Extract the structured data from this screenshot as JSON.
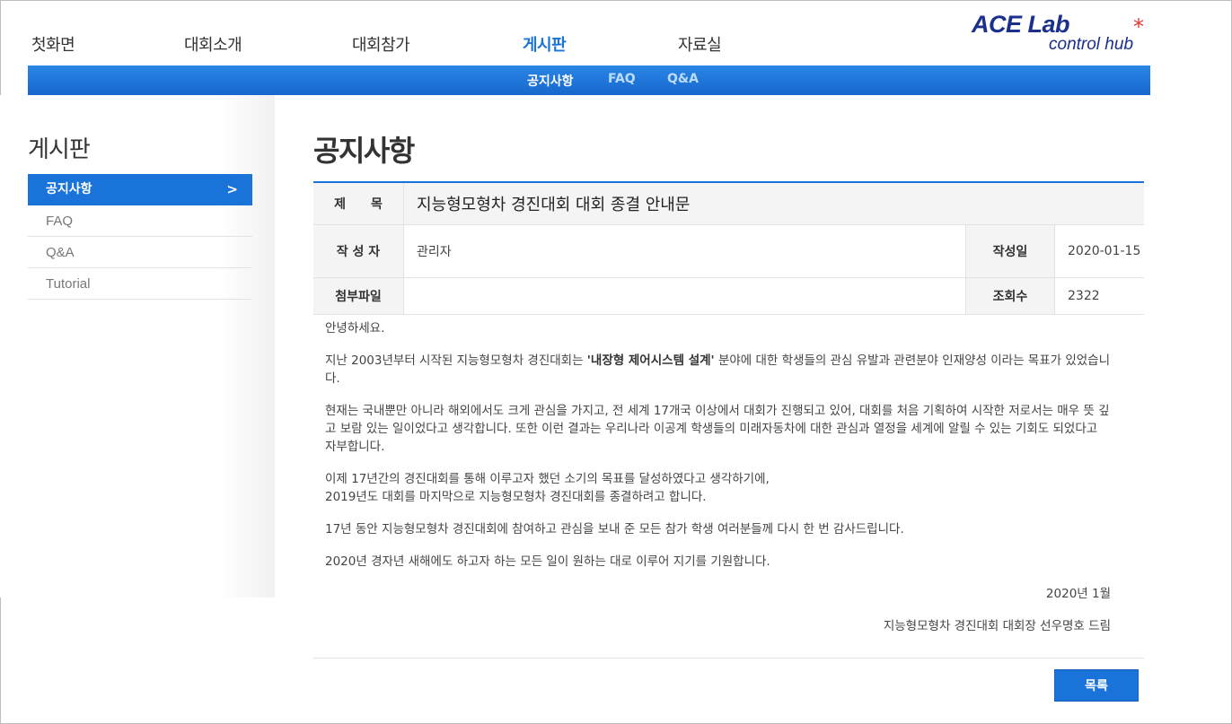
{
  "gnb": {
    "items": [
      {
        "label": "첫화면"
      },
      {
        "label": "대회소개"
      },
      {
        "label": "대회참가"
      },
      {
        "label": "게시판"
      },
      {
        "label": "자료실"
      }
    ]
  },
  "logo": {
    "line1": "ACE Lab",
    "line2": "control hub",
    "mark": "*"
  },
  "subnav": {
    "items": [
      {
        "label": "공지사항"
      },
      {
        "label": "FAQ"
      },
      {
        "label": "Q&A"
      }
    ]
  },
  "sidebar": {
    "title": "게시판",
    "items": [
      {
        "label": "공지사항"
      },
      {
        "label": "FAQ"
      },
      {
        "label": "Q&A"
      },
      {
        "label": "Tutorial"
      }
    ],
    "active_arrow": ">"
  },
  "content": {
    "title": "공지사항",
    "subject_label": "제　　목",
    "subject": "지능형모형차 경진대회 대회 종결 안내문",
    "author_label": "작 성 자",
    "author": "관리자",
    "date_label": "작성일",
    "date": "2020-01-15",
    "attach_label": "첨부파일",
    "attach": "",
    "views_label": "조회수",
    "views": "2322",
    "body": {
      "p1": "안녕하세요.",
      "p2_pre": "지난 2003년부터 시작된 지능형모형차 경진대회는 ",
      "p2_bold": "'내장형 제어시스템 설계'",
      "p2_post": " 분야에 대한 학생들의 관심 유발과 관련분야 인재양성 이라는 목표가 있었습니다.",
      "p3": "현재는 국내뿐만 아니라 해외에서도 크게 관심을 가지고, 전 세계 17개국 이상에서 대회가 진행되고 있어, 대회를 처음 기획하여 시작한 저로서는 매우 뜻 깊고 보람 있는 일이었다고 생각합니다. 또한 이런 결과는 우리나라 이공계 학생들의 미래자동차에 대한 관심과 열정을 세계에 알릴 수 있는 기회도 되었다고 자부합니다.",
      "p4a": "이제 17년간의 경진대회를 통해 이루고자 했던 소기의 목표를 달성하였다고 생각하기에,",
      "p4b": "2019년도 대회를 마지막으로 지능형모형차 경진대회를 종결하려고 합니다.",
      "p5": "17년 동안 지능형모형차 경진대회에 참여하고 관심을 보내 준 모든 참가 학생 여러분들께 다시 한 번 감사드립니다.",
      "p6": "2020년 경자년 새해에도 하고자 하는 모든 일이 원하는 대로 이루어 지기를 기원합니다.",
      "sign_date": "2020년 1월",
      "sign_name": "지능형모형차 경진대회 대회장 선우명호 드림"
    },
    "list_button": "목록"
  },
  "colors": {
    "accent": "#1a73d9",
    "logo": "#1b2f8c",
    "logo_mark": "#e53935"
  }
}
